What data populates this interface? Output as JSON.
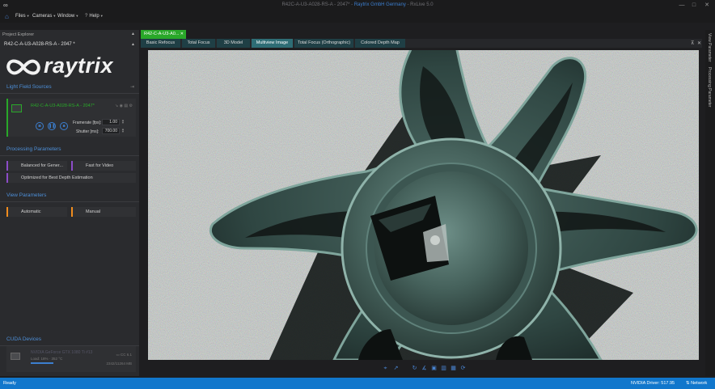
{
  "titlebar": {
    "title_prefix": "R42C-A-U3-A028-RS-A - 2047* -",
    "brand": "Raytrix GmbH Germany",
    "suffix": "- RxLive 5.0",
    "minimize": "—",
    "maximize": "□",
    "close": "✕"
  },
  "menubar": {
    "items": [
      {
        "label": "Files"
      },
      {
        "label": "Cameras"
      },
      {
        "label": "Window"
      },
      {
        "label": "Help"
      }
    ]
  },
  "left_panel": {
    "header": "Project Explorer",
    "project_name": "R42-C-A-U3-A028-RS-A - 2047 *",
    "logo_text": "raytrix",
    "light_field_sources": {
      "title": "Light Field Sources",
      "camera_name": "R42-C-A-U3-A028-RS-A - 2047*",
      "framerate_label": "Framerate [fps]:",
      "framerate_value": "1.00",
      "shutter_label": "Shutter [ms]:",
      "shutter_value": "700.00"
    },
    "processing_parameters": {
      "title": "Processing Parameters",
      "options": [
        {
          "label": "Balanced for Gener..."
        },
        {
          "label": "Fast for Video"
        },
        {
          "label": "Optimized for Best Depth Estimation"
        }
      ]
    },
    "view_parameters": {
      "title": "View Parameters",
      "options": [
        {
          "label": "Automatic"
        },
        {
          "label": "Manual"
        }
      ]
    },
    "cuda_devices": {
      "title": "CUDA Devices",
      "gpu_name": "NVIDIA GeForce GTX 1080 Ti #13",
      "load": "Load: 18% · 352 °C",
      "version": "CC 6.1",
      "memory": "2342/11264 MB"
    }
  },
  "document_tab": {
    "label": "R42-C-A-U3-A0..."
  },
  "view_tabs": [
    {
      "label": "Basic Refocus"
    },
    {
      "label": "Total Focus"
    },
    {
      "label": "3D Model"
    },
    {
      "label": "Multiview Image"
    },
    {
      "label": "Total Focus (Orthographic)"
    },
    {
      "label": "Colored Depth Map"
    }
  ],
  "active_view_tab": "Multiview Image",
  "right_strip": {
    "items": [
      {
        "label": "View Parameter"
      },
      {
        "label": "Processing Parameter"
      }
    ]
  },
  "statusbar": {
    "ready": "Ready",
    "driver": "NVIDIA Driver: 517.95",
    "network": "Network"
  },
  "colors": {
    "accent_blue": "#1177cc",
    "camera_green": "#29a829",
    "processing_purple": "#8c4cc8",
    "view_orange": "#f08c1e"
  }
}
